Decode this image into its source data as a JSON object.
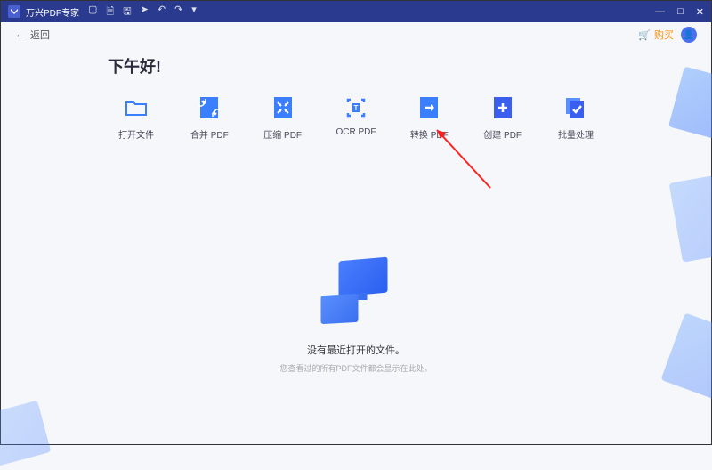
{
  "titlebar": {
    "title": "万兴PDF专家",
    "win": {
      "min": "—",
      "max": "□",
      "close": "✕"
    }
  },
  "subbar": {
    "back": "返回",
    "buy": "购买"
  },
  "greeting": "下午好!",
  "actions": [
    {
      "label": "打开文件"
    },
    {
      "label": "合并 PDF"
    },
    {
      "label": "压缩 PDF"
    },
    {
      "label": "OCR PDF"
    },
    {
      "label": "转换 PDF"
    },
    {
      "label": "创建 PDF"
    },
    {
      "label": "批量处理"
    }
  ],
  "empty": {
    "title": "没有最近打开的文件。",
    "sub": "您查看过的所有PDF文件都会显示在此处。"
  }
}
